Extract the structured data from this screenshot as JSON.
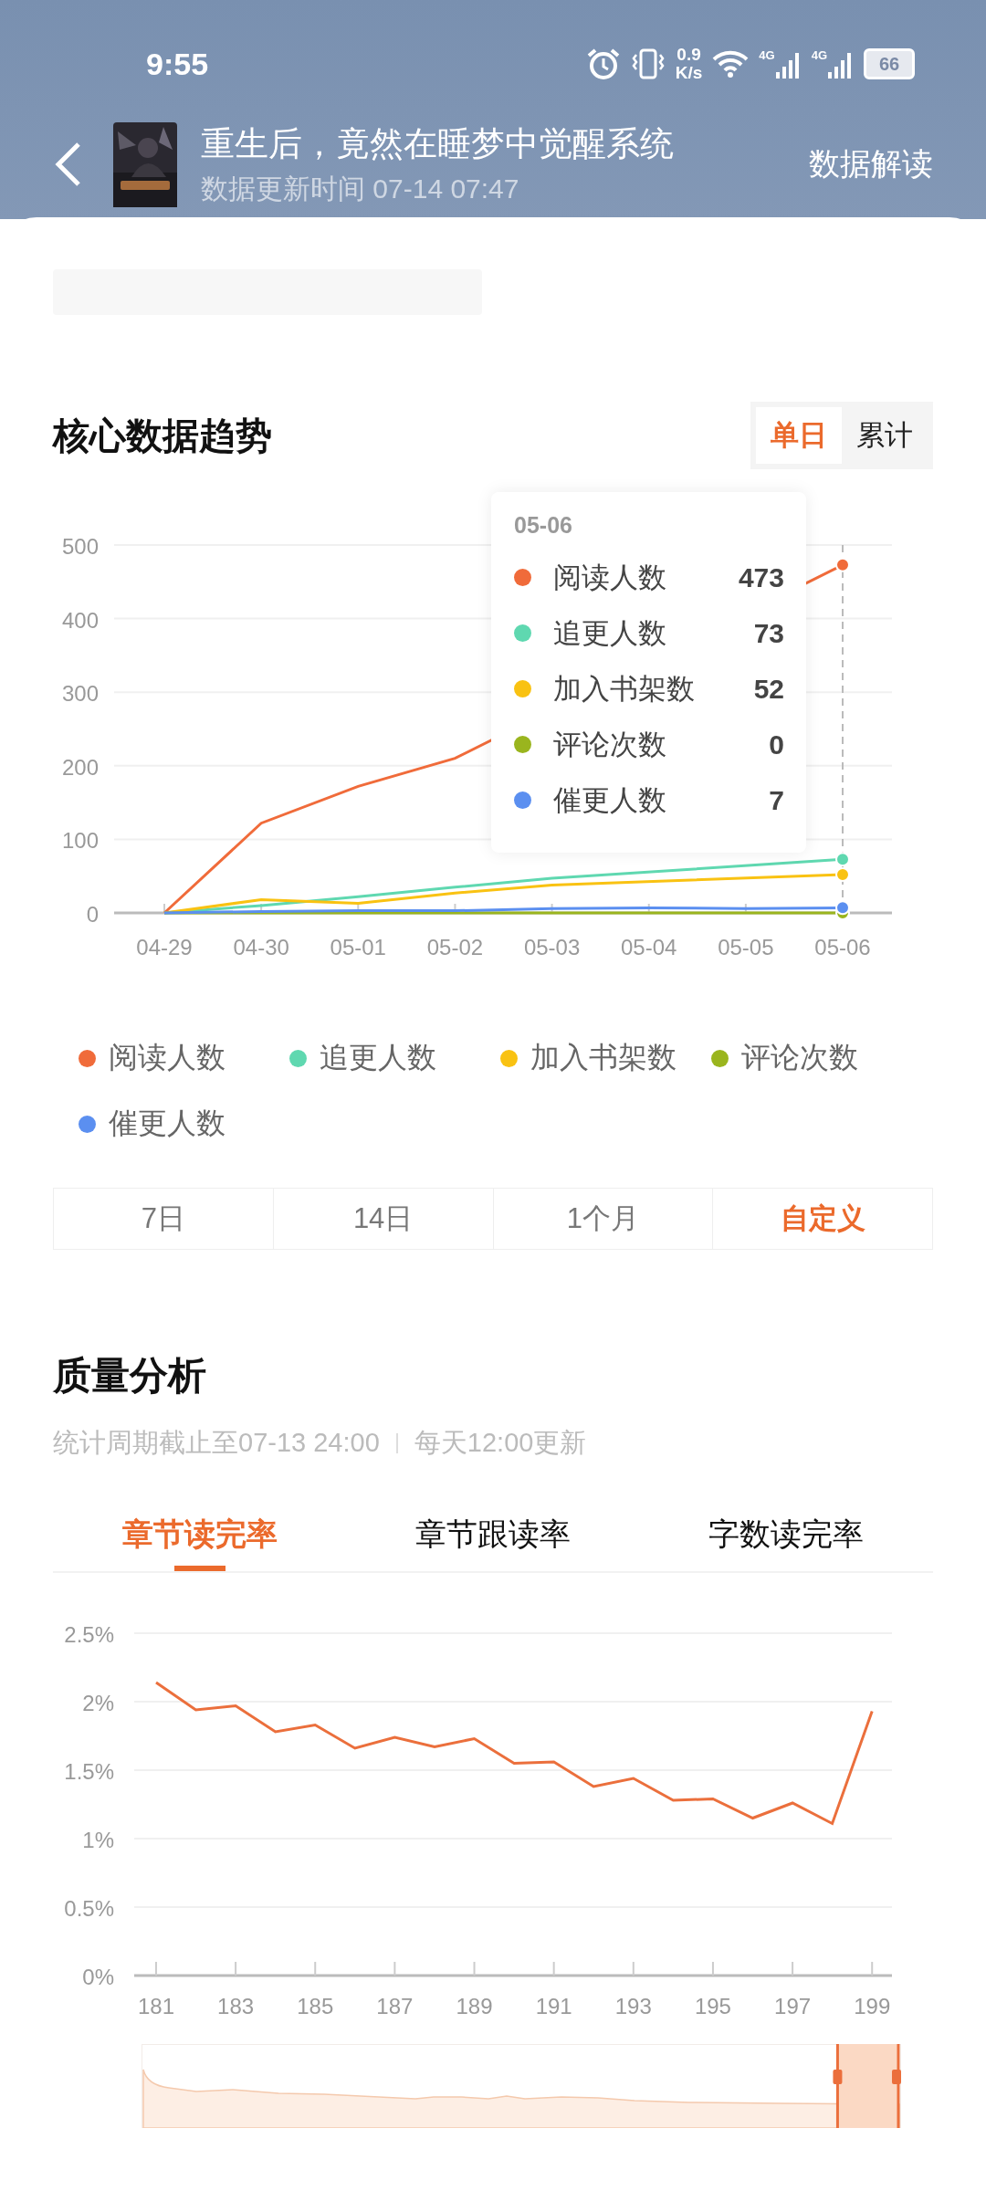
{
  "status_bar": {
    "time": "9:55",
    "net_speed_value": "0.9",
    "net_speed_unit": "K/s",
    "signal_labels": [
      "4G",
      "4G"
    ],
    "battery": "66"
  },
  "header": {
    "title": "重生后，竟然在睡梦中觉醒系统",
    "update_time": "数据更新时间 07-14 07:47",
    "action": "数据解读"
  },
  "trend": {
    "title": "核心数据趋势",
    "modes": [
      {
        "label": "单日",
        "selected": true
      },
      {
        "label": "累计",
        "selected": false
      }
    ],
    "chart_data": {
      "type": "line",
      "categories": [
        "04-29",
        "04-30",
        "05-01",
        "05-02",
        "05-03",
        "05-04",
        "05-05",
        "05-06"
      ],
      "ylim": [
        0,
        500
      ],
      "yticks": [
        0,
        100,
        200,
        300,
        400,
        500
      ],
      "grid": true,
      "legend": "bottom",
      "ref_lines": [
        {
          "axis": "x",
          "value": "05-06"
        }
      ],
      "series": [
        {
          "name": "阅读人数",
          "color": "#f06b3a",
          "values": [
            0,
            122,
            172,
            210,
            null,
            null,
            null,
            473
          ]
        },
        {
          "name": "追更人数",
          "color": "#5fd8b0",
          "values": [
            0,
            10,
            22,
            35,
            47,
            null,
            null,
            73
          ]
        },
        {
          "name": "加入书架数",
          "color": "#f9c212",
          "values": [
            0,
            18,
            13,
            27,
            38,
            null,
            null,
            52
          ]
        },
        {
          "name": "评论次数",
          "color": "#9ab51e",
          "values": [
            0,
            0,
            0,
            0,
            0,
            0,
            0,
            0
          ]
        },
        {
          "name": "催更人数",
          "color": "#5b8ff0",
          "values": [
            0,
            2,
            3,
            3,
            6,
            7,
            6,
            7
          ]
        }
      ]
    },
    "tooltip": {
      "date": "05-06",
      "items": [
        {
          "label": "阅读人数",
          "value": "473",
          "color": "#f06b3a"
        },
        {
          "label": "追更人数",
          "value": "73",
          "color": "#5fd8b0"
        },
        {
          "label": "加入书架数",
          "value": "52",
          "color": "#f9c212"
        },
        {
          "label": "评论次数",
          "value": "0",
          "color": "#9ab51e"
        },
        {
          "label": "催更人数",
          "value": "7",
          "color": "#5b8ff0"
        }
      ]
    },
    "ranges": [
      {
        "label": "7日",
        "selected": false
      },
      {
        "label": "14日",
        "selected": false
      },
      {
        "label": "1个月",
        "selected": false
      },
      {
        "label": "自定义",
        "selected": true
      }
    ]
  },
  "quality": {
    "title": "质量分析",
    "period": "统计周期截止至07-13 24:00",
    "update_note": "每天12:00更新",
    "tabs": [
      {
        "label": "章节读完率",
        "selected": true
      },
      {
        "label": "章节跟读率",
        "selected": false
      },
      {
        "label": "字数读完率",
        "selected": false
      }
    ],
    "chart_data": {
      "type": "line",
      "x": [
        181,
        182,
        183,
        184,
        185,
        186,
        187,
        188,
        189,
        190,
        191,
        192,
        193,
        194,
        195,
        196,
        197,
        198,
        199
      ],
      "xlim": [
        180.45,
        199.5
      ],
      "ylim": [
        0,
        2.5
      ],
      "grid": true,
      "xticks": [
        181,
        183,
        185,
        187,
        189,
        191,
        193,
        195,
        197,
        199
      ],
      "yticks": [
        {
          "value": 0,
          "label": "0%"
        },
        {
          "value": 0.5,
          "label": "0.5%"
        },
        {
          "value": 1,
          "label": "1%"
        },
        {
          "value": 1.5,
          "label": "1.5%"
        },
        {
          "value": 2,
          "label": "2%"
        },
        {
          "value": 2.5,
          "label": "2.5%"
        }
      ],
      "series": [
        {
          "color": "#eb6f3c",
          "values": [
            2.14,
            1.94,
            1.97,
            1.78,
            1.83,
            1.66,
            1.74,
            1.67,
            1.73,
            1.55,
            1.56,
            1.38,
            1.44,
            1.28,
            1.29,
            1.15,
            1.26,
            1.11,
            1.93
          ]
        }
      ]
    },
    "slider": {
      "level": 0.08
    }
  }
}
